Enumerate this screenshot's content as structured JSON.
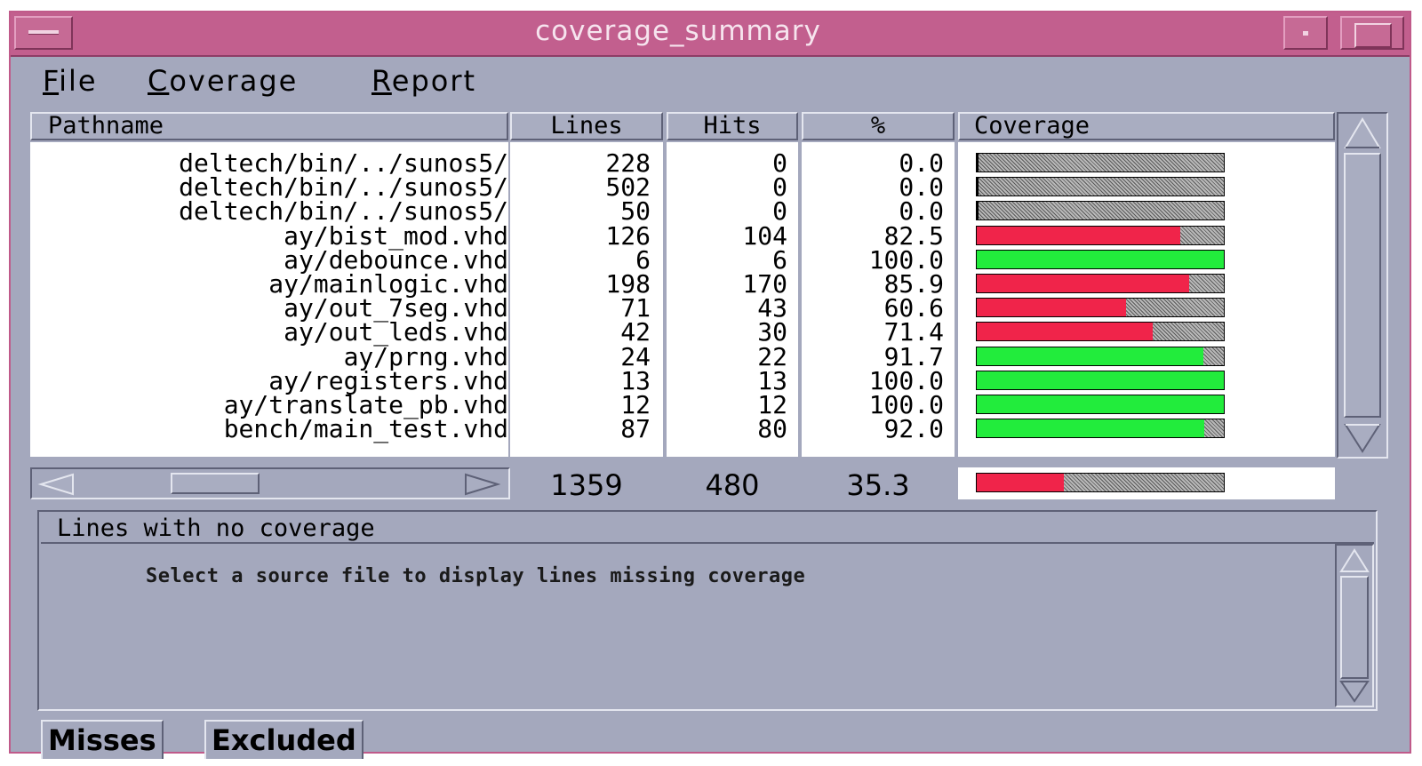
{
  "window": {
    "title": "coverage_summary"
  },
  "menu": {
    "file": "File",
    "coverage": "Coverage",
    "report": "Report"
  },
  "columns": {
    "pathname": "Pathname",
    "lines": "Lines",
    "hits": "Hits",
    "percent": "%",
    "coverage": "Coverage"
  },
  "rows": [
    {
      "path": "deltech/bin/../sunos5/",
      "lines": "228",
      "hits": "0",
      "pct": "0.0",
      "cov": 0.0,
      "color": "gray"
    },
    {
      "path": "deltech/bin/../sunos5/",
      "lines": "502",
      "hits": "0",
      "pct": "0.0",
      "cov": 0.0,
      "color": "gray"
    },
    {
      "path": "deltech/bin/../sunos5/",
      "lines": "50",
      "hits": "0",
      "pct": "0.0",
      "cov": 0.0,
      "color": "gray"
    },
    {
      "path": "ay/bist_mod.vhd",
      "lines": "126",
      "hits": "104",
      "pct": "82.5",
      "cov": 82.5,
      "color": "red"
    },
    {
      "path": "ay/debounce.vhd",
      "lines": "6",
      "hits": "6",
      "pct": "100.0",
      "cov": 100.0,
      "color": "green"
    },
    {
      "path": "ay/mainlogic.vhd",
      "lines": "198",
      "hits": "170",
      "pct": "85.9",
      "cov": 85.9,
      "color": "red"
    },
    {
      "path": "ay/out_7seg.vhd",
      "lines": "71",
      "hits": "43",
      "pct": "60.6",
      "cov": 60.6,
      "color": "red"
    },
    {
      "path": "ay/out_leds.vhd",
      "lines": "42",
      "hits": "30",
      "pct": "71.4",
      "cov": 71.4,
      "color": "red"
    },
    {
      "path": "ay/prng.vhd",
      "lines": "24",
      "hits": "22",
      "pct": "91.7",
      "cov": 91.7,
      "color": "green"
    },
    {
      "path": "ay/registers.vhd",
      "lines": "13",
      "hits": "13",
      "pct": "100.0",
      "cov": 100.0,
      "color": "green"
    },
    {
      "path": "ay/translate_pb.vhd",
      "lines": "12",
      "hits": "12",
      "pct": "100.0",
      "cov": 100.0,
      "color": "green"
    },
    {
      "path": "bench/main_test.vhd",
      "lines": "87",
      "hits": "80",
      "pct": "92.0",
      "cov": 92.0,
      "color": "green"
    }
  ],
  "totals": {
    "lines": "1359",
    "hits": "480",
    "pct": "35.3",
    "cov": 35.3,
    "color": "red"
  },
  "panel": {
    "header": "Lines with no coverage",
    "message": "Select a source file to display lines missing coverage"
  },
  "tabs": {
    "misses": "Misses",
    "excluded": "Excluded"
  },
  "colors": {
    "red": "#f0244a",
    "green": "#22ec3c",
    "titlebar": "#c25f8e",
    "chrome": "#a4a8bd"
  }
}
